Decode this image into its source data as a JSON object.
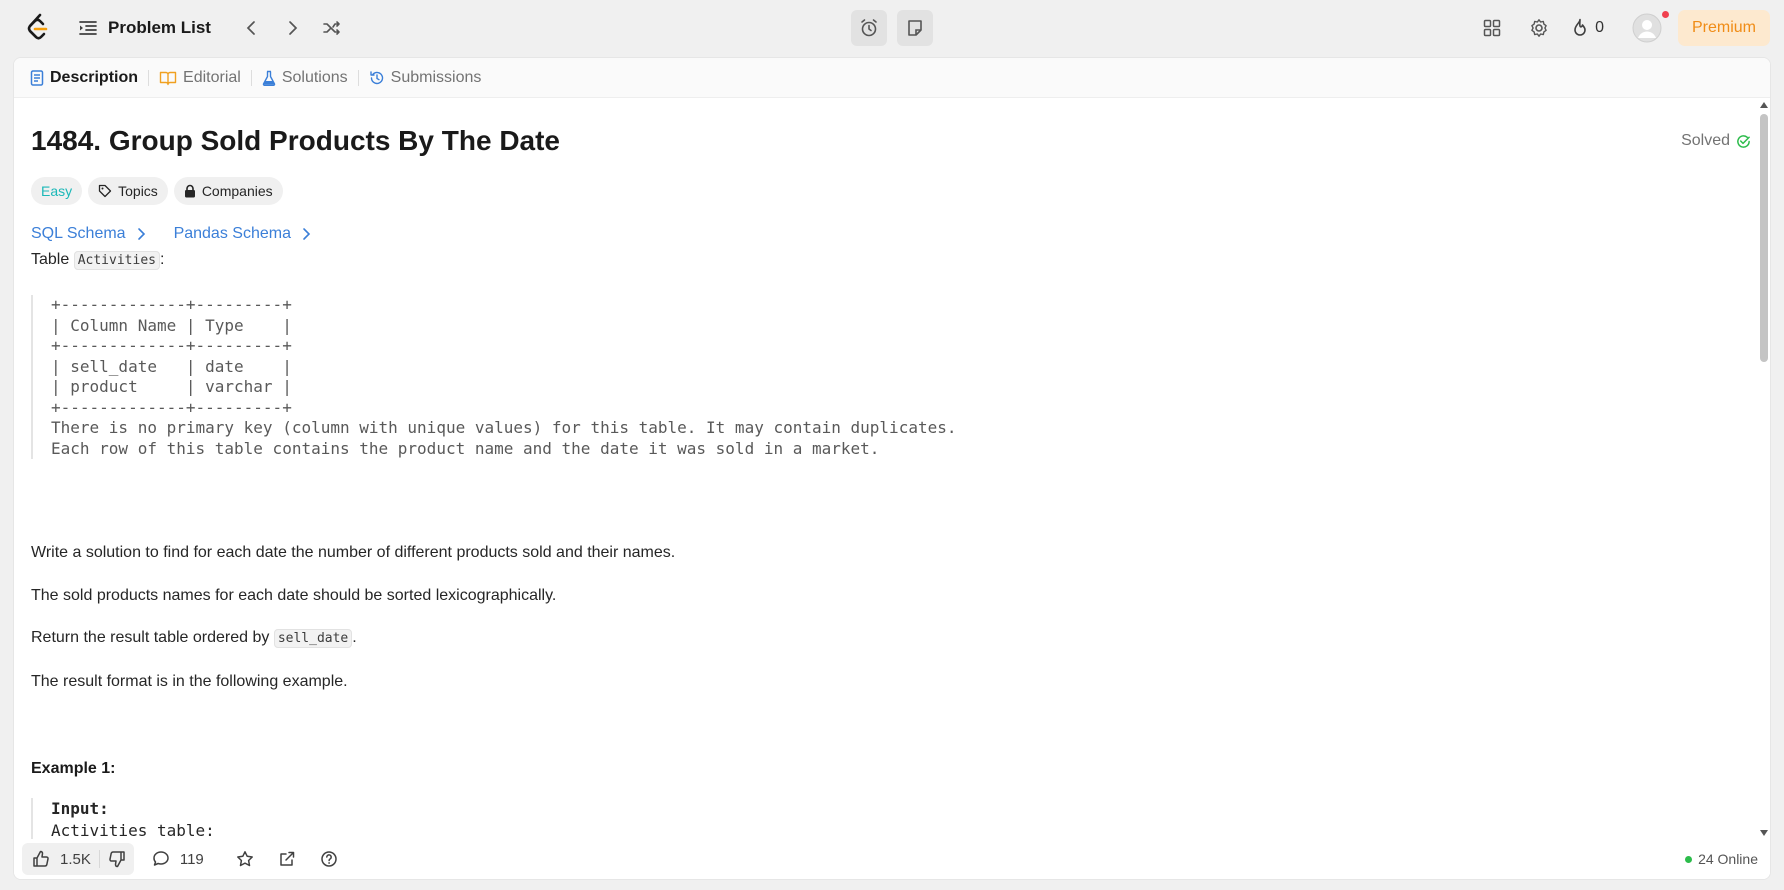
{
  "topbar": {
    "problem_list": "Problem List",
    "streak_count": "0",
    "premium": "Premium"
  },
  "tabs": [
    {
      "label": "Description",
      "icon": "description-icon"
    },
    {
      "label": "Editorial",
      "icon": "book-icon"
    },
    {
      "label": "Solutions",
      "icon": "flask-icon"
    },
    {
      "label": "Submissions",
      "icon": "history-icon"
    }
  ],
  "problem": {
    "title": "1484. Group Sold Products By The Date",
    "status": "Solved",
    "tags": {
      "difficulty": "Easy",
      "topics": "Topics",
      "companies": "Companies"
    },
    "schemas": [
      "SQL Schema",
      "Pandas Schema"
    ],
    "table_prefix": "Table ",
    "table_name": "Activities",
    "table_suffix": ":",
    "schema_lines": [
      "+-------------+---------+",
      "| Column Name | Type    |",
      "+-------------+---------+",
      "| sell_date   | date    |",
      "| product     | varchar |",
      "+-------------+---------+",
      "There is no primary key (column with unique values) for this table. It may contain duplicates.",
      "Each row of this table contains the product name and the date it was sold in a market."
    ],
    "p1": "Write a solution to find for each date the number of different products sold and their names.",
    "p2": "The sold products names for each date should be sorted lexicographically.",
    "p3_prefix": "Return the result table ordered by ",
    "p3_code": "sell_date",
    "p3_suffix": ".",
    "p4": "The result format is in the following example.",
    "example_title": "Example 1:",
    "example_input_label": "Input:",
    "example_table_label": "Activities table:"
  },
  "bottombar": {
    "likes": "1.5K",
    "comments": "119",
    "online": "24 Online"
  },
  "colors": {
    "easy": "#1cb8b8",
    "link": "#3b7fd8",
    "premium_text": "#f08c16",
    "solved_check": "#2cbc4b"
  }
}
